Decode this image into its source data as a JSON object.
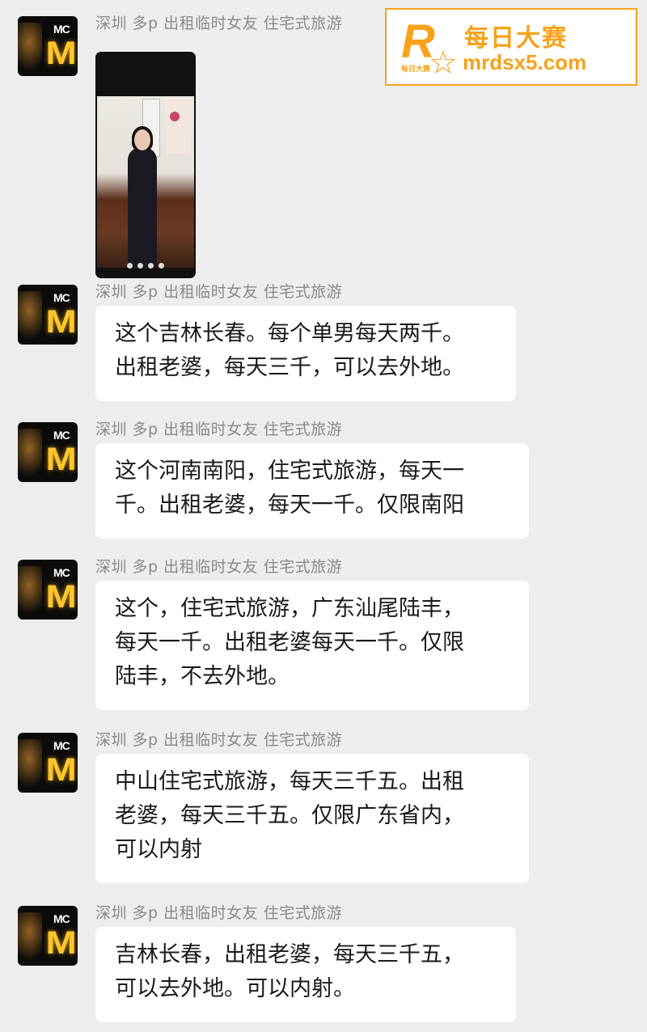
{
  "watermark": {
    "brand_cn": "每日大赛",
    "url": "mrdsx5.com",
    "logo_letter": "R",
    "logo_small": "每日大赛",
    "color": "#f7a21b"
  },
  "sender_name": "深圳 多p 出租临时女友 住宅式旅游",
  "messages": [
    {
      "type": "image",
      "avatar_sign": "MC",
      "avatar_arches": "M"
    },
    {
      "type": "text",
      "avatar_sign": "MC",
      "avatar_arches": "M",
      "lines": [
        "这个吉林长春。每个单男每天两千。",
        "出租老婆，每天三千，可以去外地。"
      ]
    },
    {
      "type": "text",
      "avatar_sign": "MC",
      "avatar_arches": "M",
      "lines": [
        "这个河南南阳，住宅式旅游，每天一",
        "千。出租老婆，每天一千。仅限南阳"
      ]
    },
    {
      "type": "text",
      "avatar_sign": "MC",
      "avatar_arches": "M",
      "lines": [
        "这个，住宅式旅游，广东汕尾陆丰，",
        "每天一千。出租老婆每天一千。仅限",
        "陆丰，不去外地。"
      ]
    },
    {
      "type": "text",
      "avatar_sign": "MC",
      "avatar_arches": "M",
      "lines": [
        "中山住宅式旅游，每天三千五。出租",
        "老婆，每天三千五。仅限广东省内，",
        "可以内射"
      ]
    },
    {
      "type": "text",
      "avatar_sign": "MC",
      "avatar_arches": "M",
      "lines": [
        "吉林长春，出租老婆，每天三千五，",
        "可以去外地。可以内射。"
      ]
    }
  ]
}
